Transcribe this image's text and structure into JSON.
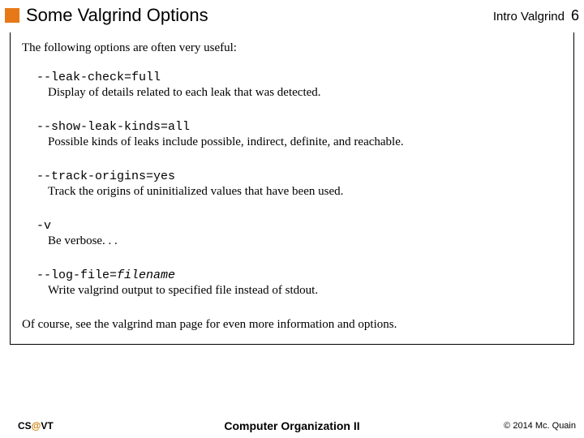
{
  "header": {
    "title": "Some Valgrind Options",
    "section": "Intro Valgrind",
    "page": "6"
  },
  "body": {
    "intro": "The following options are often very useful:",
    "options": [
      {
        "flag": "--leak-check=full",
        "arg": "",
        "desc": "Display of details related to each leak that was detected."
      },
      {
        "flag": "--show-leak-kinds=all",
        "arg": "",
        "desc": "Possible kinds of leaks include possible, indirect, definite, and reachable."
      },
      {
        "flag": "--track-origins=yes",
        "arg": "",
        "desc": "Track the origins of uninitialized values that have been used."
      },
      {
        "flag": "-v",
        "arg": "",
        "desc": "Be verbose. . ."
      },
      {
        "flag": "--log-file=",
        "arg": "filename",
        "desc": "Write valgrind output to specified file instead of stdout."
      }
    ],
    "outro": "Of course, see the valgrind man page for even more information and options."
  },
  "footer": {
    "left_pre": "CS",
    "left_at": "@",
    "left_post": "VT",
    "center": "Computer Organization II",
    "right": "© 2014 Mc. Quain"
  }
}
